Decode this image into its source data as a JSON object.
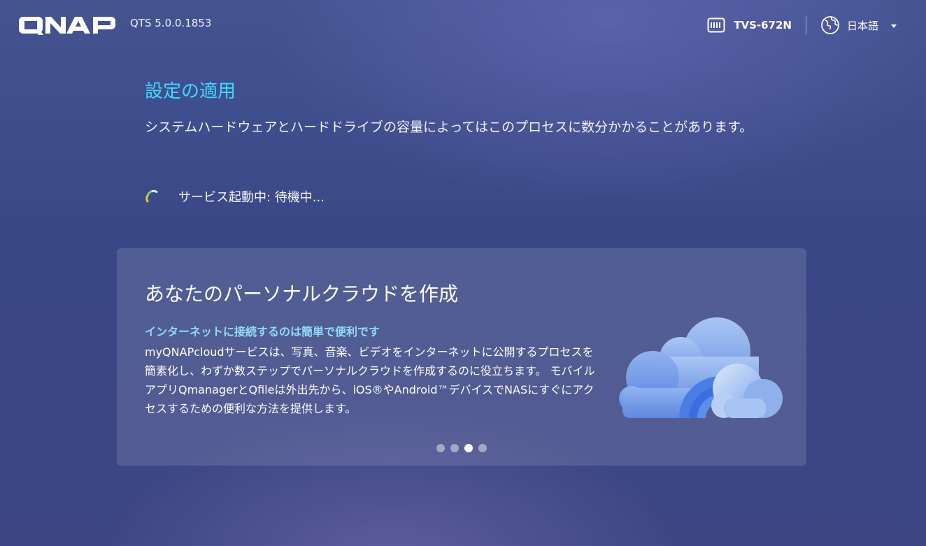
{
  "header": {
    "logo_text": "QNAP",
    "version": "QTS 5.0.0.1853",
    "device_name": "TVS-672N",
    "language": "日本語"
  },
  "main": {
    "title": "設定の適用",
    "description": "システムハードウェアとハードドライブの容量によってはこのプロセスに数分かかることがあります。",
    "status_text": "サービス起動中: 待機中..."
  },
  "card": {
    "title": "あなたのパーソナルクラウドを作成",
    "subtitle": "インターネットに接続するのは簡単で便利です",
    "body": "myQNAPcloudサービスは、写真、音楽、ビデオをインターネットに公開するプロセスを簡素化し、わずか数ステップでパーソナルクラウドを作成するのに役立ちます。 モバイルアプリQmanagerとQfileは外出先から、iOS®やAndroid™デバイスでNASにすぐにアクセスするための便利な方法を提供します。",
    "carousel": {
      "total": 4,
      "active_index": 2
    }
  },
  "colors": {
    "title_accent": "#3fd8ff",
    "subtitle_accent": "#8fdcf7"
  },
  "icons": [
    "qnap-logo",
    "nas-device-icon",
    "globe-icon",
    "chevron-down-icon",
    "loading-spinner-icon",
    "cloud-illustration"
  ]
}
